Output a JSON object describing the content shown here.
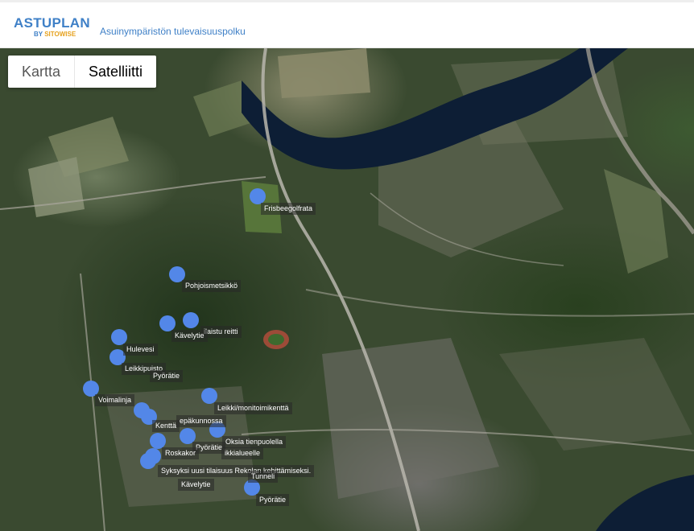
{
  "header": {
    "logo": {
      "main": "ASTUPLAN",
      "by": "BY",
      "brand": "SITOWISE"
    },
    "tagline": "Asuinympäristön tulevaisuuspolku"
  },
  "map_controls": {
    "map_type_buttons": [
      {
        "label": "Kartta",
        "selected": false
      },
      {
        "label": "Satelliitti",
        "selected": true
      }
    ]
  },
  "colors": {
    "brand_blue": "#3f80c7",
    "brand_orange": "#e6a21f",
    "marker_blue": "#5387e8",
    "water": "#0d1e35"
  },
  "points_of_interest": [
    "Frisbeegolfrata",
    "Pohjoismetsikkö",
    "ilaistu reitti",
    "Kävelytie",
    "Hulevesi",
    "Leikkipuisto",
    "Pyörätie",
    "Voimalinja",
    "Leikki/monitoimikenttä",
    "Kenttä",
    "epäkunnossa",
    "Oksia tienpuolella",
    "Pyörätie",
    "Roskakor",
    "ikkialueelle",
    "Syksyksi uusi tilaisuus Rekolan kehittämiseksi.",
    "Tunneli",
    "Kävelytie",
    "Pyörätie"
  ]
}
